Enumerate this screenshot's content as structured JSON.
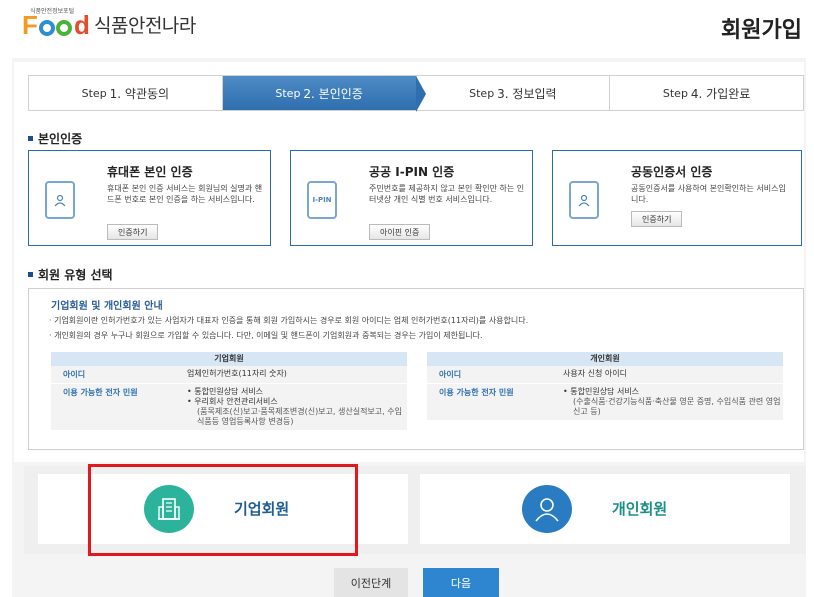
{
  "header": {
    "logo_small": "식품안전정보포털",
    "logo_name": "식품안전나라",
    "page_title": "회원가입"
  },
  "steps": [
    {
      "prefix": "Step",
      "label": "1. 약관동의",
      "active": false
    },
    {
      "prefix": "Step",
      "label": "2. 본인인증",
      "active": true
    },
    {
      "prefix": "Step",
      "label": "3. 정보입력",
      "active": false
    },
    {
      "prefix": "Step",
      "label": "4. 가입완료",
      "active": false
    }
  ],
  "auth_section": {
    "title": "본인인증",
    "options": [
      {
        "icon": "mobile-phone-icon",
        "title": "휴대폰 본인 인증",
        "desc": "휴대폰 본인 인증 서비스는 회원님의 실명과 핸드폰 번호로 본인 인증을 하는 서비스입니다.",
        "button": "인증하기"
      },
      {
        "icon": "ipin-icon",
        "icon_text": "I-PIN",
        "title": "공공 I-PIN 인증",
        "desc": "주민번호를 제공하지 않고 본인 확인만 하는 인터넷상 개인 식별 번호 서비스입니다.",
        "button": "아이핀 인증"
      },
      {
        "icon": "certificate-phone-icon",
        "title": "공동인증서 인증",
        "desc": "공동인증서를 사용하여 본인확인하는 서비스입니다.",
        "button": "인증하기"
      }
    ]
  },
  "type_section": {
    "title": "회원 유형 선택",
    "info_heading": "기업회원 및 개인회원 안내",
    "notes": [
      "· 기업회원이란 인허가번호가 있는 사업자가 대표자 인증을 통해 회원 가입하시는 경우로 회원 아이디는 업체 인허가번호(11자리)를 사용합니다.",
      "· 개인회원의 경우 누구나 회원으로 가입할 수 있습니다. 다만, 이메일 및 핸드폰이 기업회원과 중복되는 경우는 가입이 제한됩니다."
    ],
    "corp_table": {
      "header": "기업회원",
      "id_key": "아이디",
      "id_value": "업체인허가번호(11자리 숫자)",
      "svc_key": "이용 가능한 전자 민원",
      "svc_1": "• 통합민원상담 서비스",
      "svc_2": "• 우리회사 안전관리서비스",
      "svc_2_sub": "(품목제조(신)보고·품목제조변경(신)보고, 생산실적보고, 수입식품등 영업등록사항 변경등)"
    },
    "indiv_table": {
      "header": "개인회원",
      "id_key": "아이디",
      "id_value": "사용자 신청 아이디",
      "svc_key": "이용 가능한 전자 민원",
      "svc_1": "• 통합민원상담 서비스",
      "svc_1_sub": "(수출식품·건강기능식품·축산물 영문 증명, 수입식품 관련 영업신고 등)"
    }
  },
  "choices": {
    "corp": {
      "label": "기업회원",
      "icon": "building-icon"
    },
    "indiv": {
      "label": "개인회원",
      "icon": "person-icon"
    }
  },
  "buttons": {
    "prev": "이전단계",
    "next": "다음"
  },
  "colors": {
    "accent": "#2f6fae",
    "corp_circle": "#2bb39b",
    "indiv_circle": "#2a7cc2",
    "highlight": "#e3181f"
  }
}
